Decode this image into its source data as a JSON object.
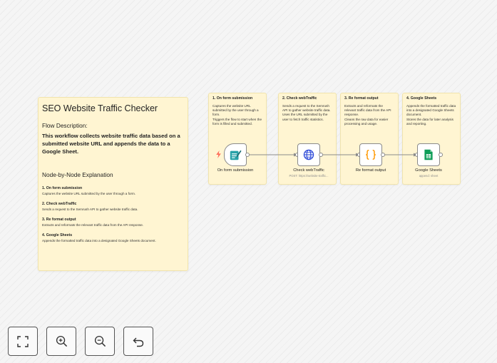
{
  "main_note": {
    "title": "SEO Website Traffic Checker",
    "flow_label": "Flow Description:",
    "flow_desc": "This workflow collects website traffic data based on a submitted website URL and appends the data to a Google Sheet.",
    "section_title": "Node-by-Node Explanation",
    "items": [
      {
        "title": "1. On form submission",
        "desc": "Captures the website URL submitted by the user through a form."
      },
      {
        "title": "2. Check webTraffic",
        "desc": "Sends a request to the Semrush API to gather website traffic data."
      },
      {
        "title": "3. Re format output",
        "desc": "Extracts and reformats the relevant traffic data from the API response."
      },
      {
        "title": "4. Google Sheets",
        "desc": "Appends the formatted traffic data into a designated Google Sheets document."
      }
    ]
  },
  "column_notes": [
    {
      "title": "1. On form submission",
      "desc": "Captures the website URL submitted by the user through a form.\nTriggers the flow to start when the form is filled and submitted."
    },
    {
      "title": "2. Check webTraffic",
      "desc": "Sends a request to the Semrush API to gather website traffic data.\nUses the URL submitted by the user to fetch traffic statistics."
    },
    {
      "title": "3. Re format output",
      "desc": "Extracts and reformats the relevant traffic data from the API response.\nCleans the raw data for easier processing and usage."
    },
    {
      "title": "4. Google Sheets",
      "desc": "Appends the formatted traffic data into a designated Google Sheets document.\nStores the data for later analysis and reporting."
    }
  ],
  "nodes": [
    {
      "label": "On form submission",
      "sub": "",
      "icon": "form-icon"
    },
    {
      "label": "Check webTraffic",
      "sub": "POST: https://website-traffic...",
      "icon": "globe-icon"
    },
    {
      "label": "Re format output",
      "sub": "",
      "icon": "code-braces-icon"
    },
    {
      "label": "Google Sheets",
      "sub": "append: sheet",
      "icon": "google-sheets-icon"
    }
  ],
  "controls": [
    "fit-view-icon",
    "zoom-in-icon",
    "zoom-out-icon",
    "undo-icon"
  ],
  "colors": {
    "note_bg": "#fff5d2",
    "trigger_accent": "#ff6d5a",
    "sheets_green": "#0f9d58",
    "code_orange": "#ff9800",
    "globe_blue": "#2f4bd8",
    "form_teal": "#27a2a8"
  }
}
